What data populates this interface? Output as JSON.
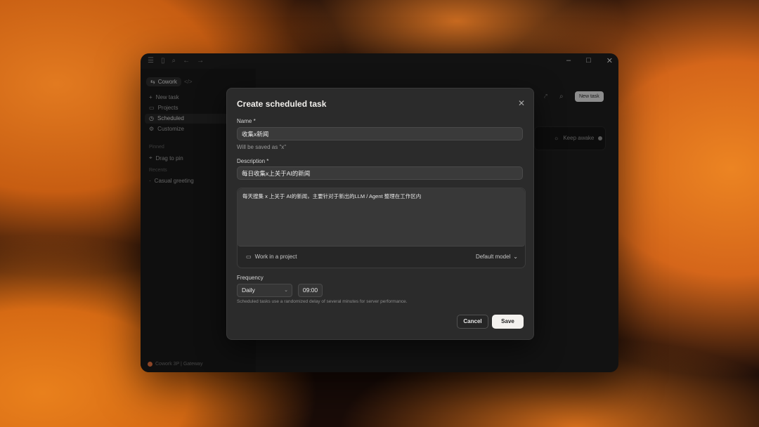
{
  "window": {
    "sidebar": {
      "workspace_chip": "Cowork",
      "items": [
        {
          "icon": "plus-icon",
          "glyph": "+",
          "label": "New task"
        },
        {
          "icon": "folder-icon",
          "glyph": "▭",
          "label": "Projects"
        },
        {
          "icon": "clock-icon",
          "glyph": "◷",
          "label": "Scheduled"
        },
        {
          "icon": "sliders-icon",
          "glyph": "⚙",
          "label": "Customize"
        }
      ],
      "pinned_label": "Pinned",
      "pinned_hint": "Drag to pin",
      "recents_label": "Recents",
      "recents": [
        "Casual greeting"
      ],
      "footer": "Cowork 3P | Gateway"
    },
    "main": {
      "new_task_button": "New task",
      "keep_awake_label": "Keep awake"
    }
  },
  "modal": {
    "title": "Create scheduled task",
    "name_label": "Name *",
    "name_value": "收集x新闻",
    "name_helper": "Will be saved as \"x\"",
    "description_label": "Description *",
    "description_value": "每日收集x上关于AI的新闻",
    "prompt_value": "每天搜集 x 上关于 AI的新闻，主要针对于新出的LLM / Agent 整理在工作区内",
    "work_in_project_label": "Work in a project",
    "model_label": "Default model",
    "frequency_label": "Frequency",
    "frequency_value": "Daily",
    "time_value": "09:00",
    "frequency_note": "Scheduled tasks use a randomized delay of several minutes for server performance.",
    "cancel_label": "Cancel",
    "save_label": "Save"
  }
}
